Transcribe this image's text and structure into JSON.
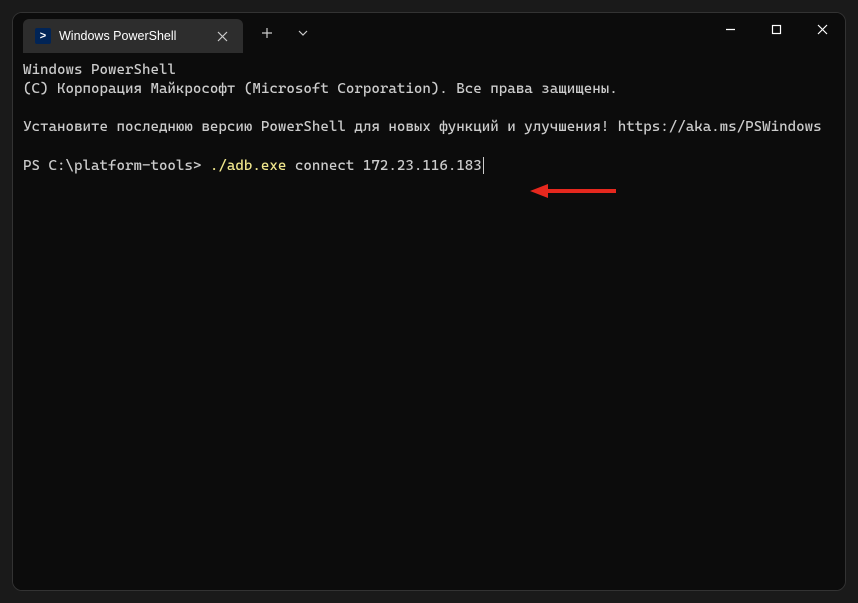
{
  "tab": {
    "title": "Windows PowerShell"
  },
  "terminal": {
    "line1": "Windows PowerShell",
    "line2": "(C) Корпорация Майкрософт (Microsoft Corporation). Все права защищены.",
    "line3": "Установите последнюю версию PowerShell для новых функций и улучшения! https://aka.ms/PSWindows",
    "prompt": "PS C:\\platform-tools> ",
    "cmd_exe": "./adb.exe",
    "cmd_args": " connect 172.23.116.183"
  }
}
